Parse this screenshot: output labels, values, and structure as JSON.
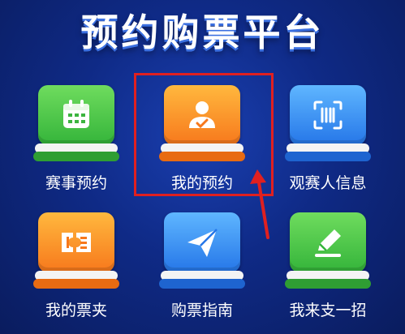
{
  "header": {
    "title": "预约购票平台"
  },
  "menu": {
    "items": [
      {
        "label": "赛事预约",
        "icon": "calendar-icon",
        "color": "green"
      },
      {
        "label": "我的预约",
        "icon": "user-check-icon",
        "color": "orange"
      },
      {
        "label": "观赛人信息",
        "icon": "scan-icon",
        "color": "blue"
      },
      {
        "label": "我的票夹",
        "icon": "ticket-icon",
        "color": "orange"
      },
      {
        "label": "购票指南",
        "icon": "paper-plane-icon",
        "color": "blue"
      },
      {
        "label": "我来支一招",
        "icon": "edit-icon",
        "color": "green"
      }
    ]
  },
  "annotation": {
    "highlight_color": "#e02020",
    "highlighted_item": "我的预约"
  }
}
